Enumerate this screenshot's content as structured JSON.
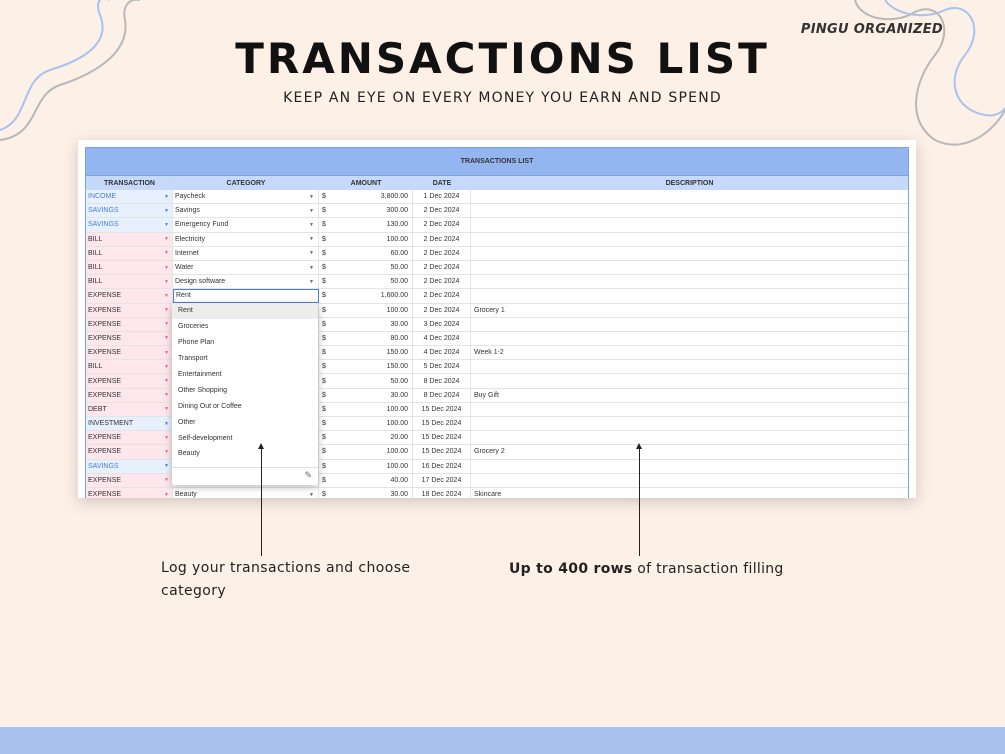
{
  "brand": "PINGU ORGANIZED",
  "title": "TRANSACTIONS LIST",
  "subtitle": "KEEP AN EYE ON EVERY MONEY YOU EARN AND SPEND",
  "sheet": {
    "title": "TRANSACTIONS LIST",
    "headers": {
      "transaction": "TRANSACTION",
      "category": "CATEGORY",
      "amount": "AMOUNT",
      "date": "DATE",
      "description": "DESCRIPTION"
    },
    "currency": "$",
    "rows": [
      {
        "type": "INCOME",
        "category": "Paycheck",
        "amount": "3,800.00",
        "date": "1 Dec 2024",
        "description": ""
      },
      {
        "type": "SAVINGS",
        "category": "Savings",
        "amount": "300.00",
        "date": "2 Dec 2024",
        "description": ""
      },
      {
        "type": "SAVINGS",
        "category": "Emergency Fund",
        "amount": "130.00",
        "date": "2 Dec 2024",
        "description": ""
      },
      {
        "type": "BILL",
        "category": "Electricity",
        "amount": "100.00",
        "date": "2 Dec 2024",
        "description": ""
      },
      {
        "type": "BILL",
        "category": "Internet",
        "amount": "60.00",
        "date": "2 Dec 2024",
        "description": ""
      },
      {
        "type": "BILL",
        "category": "Water",
        "amount": "50.00",
        "date": "2 Dec 2024",
        "description": ""
      },
      {
        "type": "BILL",
        "category": "Design software",
        "amount": "50.00",
        "date": "2 Dec 2024",
        "description": ""
      },
      {
        "type": "EXPENSE",
        "category": "Rent",
        "amount": "1,600.00",
        "date": "2 Dec 2024",
        "description": ""
      },
      {
        "type": "EXPENSE",
        "category": "",
        "amount": "100.00",
        "date": "2 Dec 2024",
        "description": "Grocery 1"
      },
      {
        "type": "EXPENSE",
        "category": "",
        "amount": "30.00",
        "date": "3 Dec 2024",
        "description": ""
      },
      {
        "type": "EXPENSE",
        "category": "",
        "amount": "80.00",
        "date": "4 Dec 2024",
        "description": ""
      },
      {
        "type": "EXPENSE",
        "category": "",
        "amount": "150.00",
        "date": "4 Dec 2024",
        "description": "Week 1-2"
      },
      {
        "type": "BILL",
        "category": "",
        "amount": "150.00",
        "date": "5 Dec 2024",
        "description": ""
      },
      {
        "type": "EXPENSE",
        "category": "",
        "amount": "50.00",
        "date": "8 Dec 2024",
        "description": ""
      },
      {
        "type": "EXPENSE",
        "category": "",
        "amount": "30.00",
        "date": "8 Dec 2024",
        "description": "Buy Gift"
      },
      {
        "type": "DEBT",
        "category": "",
        "amount": "100.00",
        "date": "15 Dec 2024",
        "description": ""
      },
      {
        "type": "INVESTMENT",
        "category": "",
        "amount": "100.00",
        "date": "15 Dec 2024",
        "description": ""
      },
      {
        "type": "EXPENSE",
        "category": "",
        "amount": "20.00",
        "date": "15 Dec 2024",
        "description": ""
      },
      {
        "type": "EXPENSE",
        "category": "",
        "amount": "100.00",
        "date": "15 Dec 2024",
        "description": "Grocery 2"
      },
      {
        "type": "SAVINGS",
        "category": "",
        "amount": "100.00",
        "date": "16 Dec 2024",
        "description": ""
      },
      {
        "type": "EXPENSE",
        "category": "",
        "amount": "40.00",
        "date": "17 Dec 2024",
        "description": ""
      },
      {
        "type": "EXPENSE",
        "category": "Beauty",
        "amount": "30.00",
        "date": "18 Dec 2024",
        "description": "Skincare"
      }
    ]
  },
  "dropdown": {
    "selected": "Rent",
    "options": [
      "Rent",
      "Groceries",
      "Phone Plan",
      "Transport",
      "Entertainment",
      "Other Shopping",
      "Dining Out or Coffee",
      "Other",
      "Self-development",
      "Beauty"
    ],
    "edit_icon": "pencil-icon"
  },
  "annotations": {
    "left": "Log your transactions and choose category",
    "right_bold": "Up to 400 rows",
    "right_rest": " of transaction filling"
  },
  "colors": {
    "background": "#fdf0e7",
    "header_blue": "#93b5f0",
    "subheader_blue": "#c7d9fb",
    "income_text": "#4a7fd8",
    "pink_fill": "#fde7ec",
    "blue_fill": "#e7f0fd",
    "footer": "#a9c2f0"
  }
}
